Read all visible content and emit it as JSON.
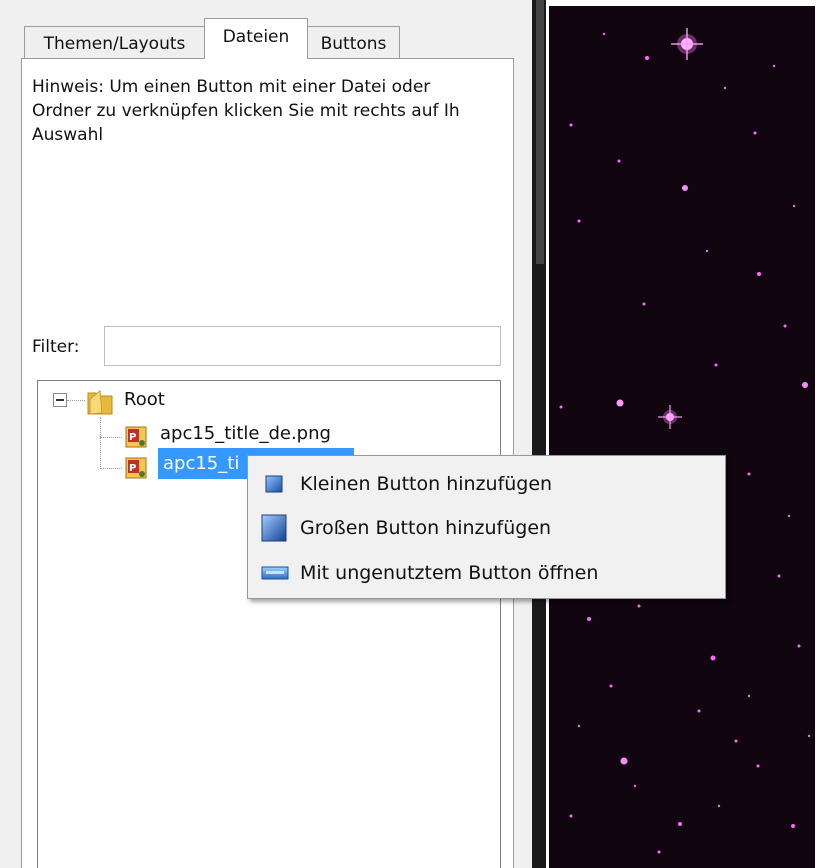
{
  "tabs": {
    "themes_layouts": "Themen/Layouts",
    "files": "Dateien",
    "buttons": "Buttons"
  },
  "hint_text": "Hinweis: Um einen Button mit einer Datei oder\nOrdner zu verknüpfen klicken Sie mit rechts auf Ih\nAuswahl",
  "filter": {
    "label": "Filter:",
    "value": ""
  },
  "tree": {
    "root_label": "Root",
    "files": [
      {
        "label": "apc15_title_de.png"
      },
      {
        "label": "apc15_ti"
      }
    ]
  },
  "context_menu": {
    "items": [
      {
        "label": "Kleinen Button hinzufügen",
        "icon": "small-button-icon"
      },
      {
        "label": "Großen Button hinzufügen",
        "icon": "large-button-icon"
      },
      {
        "label": "Mit ungenutztem Button öffnen",
        "icon": "unused-button-icon"
      }
    ]
  },
  "colors": {
    "selection": "#3399ff",
    "preview_bg": "#110510",
    "star": "#ff66ff"
  }
}
